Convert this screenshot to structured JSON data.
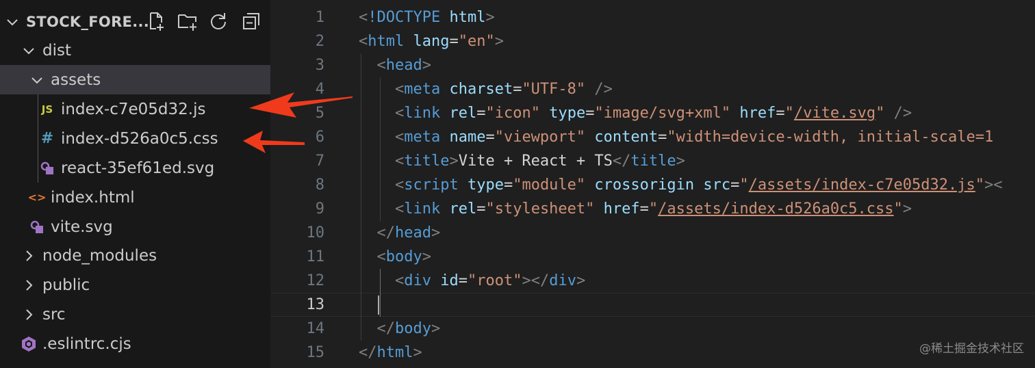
{
  "explorer": {
    "root_label": "STOCK_FORE...",
    "toolbar": [
      {
        "name": "new-file-icon",
        "label": "New File"
      },
      {
        "name": "new-folder-icon",
        "label": "New Folder"
      },
      {
        "name": "refresh-icon",
        "label": "Refresh"
      },
      {
        "name": "collapse-all-icon",
        "label": "Collapse All"
      }
    ],
    "items": [
      {
        "label": "dist",
        "kind": "folder",
        "expanded": true,
        "depth": 1
      },
      {
        "label": "assets",
        "kind": "folder",
        "expanded": true,
        "depth": 2,
        "selected": true
      },
      {
        "label": "index-c7e05d32.js",
        "kind": "js",
        "icon_text": "JS",
        "depth": 3
      },
      {
        "label": "index-d526a0c5.css",
        "kind": "css",
        "icon_text": "#",
        "depth": 3
      },
      {
        "label": "react-35ef61ed.svg",
        "kind": "svg",
        "depth": 3
      },
      {
        "label": "index.html",
        "kind": "html",
        "icon_text": "<>",
        "depth": 2
      },
      {
        "label": "vite.svg",
        "kind": "svg",
        "depth": 2
      },
      {
        "label": "node_modules",
        "kind": "folder",
        "expanded": false,
        "depth": 1
      },
      {
        "label": "public",
        "kind": "folder",
        "expanded": false,
        "depth": 1
      },
      {
        "label": "src",
        "kind": "folder",
        "expanded": false,
        "depth": 1
      },
      {
        "label": ".eslintrc.cjs",
        "kind": "eslint",
        "depth": 1
      }
    ],
    "colors": {
      "js": "#cbcb41",
      "css": "#519aba",
      "html": "#e37933",
      "svg": "#a074c4",
      "eslint": "#a074c4"
    }
  },
  "editor": {
    "current_line": 13,
    "lines": [
      {
        "n": "1",
        "tokens": [
          [
            "t-punc",
            "<"
          ],
          [
            "t-tag",
            "!DOCTYPE"
          ],
          [
            "t-text",
            " "
          ],
          [
            "t-attr",
            "html"
          ],
          [
            "t-punc",
            ">"
          ]
        ]
      },
      {
        "n": "2",
        "tokens": [
          [
            "t-punc",
            "<"
          ],
          [
            "t-tag",
            "html"
          ],
          [
            "t-text",
            " "
          ],
          [
            "t-attr",
            "lang"
          ],
          [
            "t-text",
            "="
          ],
          [
            "t-str",
            "\"en\""
          ],
          [
            "t-punc",
            ">"
          ]
        ]
      },
      {
        "n": "3",
        "tokens": [
          [
            "t-text",
            "  "
          ],
          [
            "t-punc",
            "<"
          ],
          [
            "t-tag",
            "head"
          ],
          [
            "t-punc",
            ">"
          ]
        ]
      },
      {
        "n": "4",
        "tokens": [
          [
            "t-text",
            "    "
          ],
          [
            "t-punc",
            "<"
          ],
          [
            "t-tag",
            "meta"
          ],
          [
            "t-text",
            " "
          ],
          [
            "t-attr",
            "charset"
          ],
          [
            "t-text",
            "="
          ],
          [
            "t-str",
            "\"UTF-8\""
          ],
          [
            "t-text",
            " "
          ],
          [
            "t-punc",
            "/>"
          ]
        ]
      },
      {
        "n": "5",
        "tokens": [
          [
            "t-text",
            "    "
          ],
          [
            "t-punc",
            "<"
          ],
          [
            "t-tag",
            "link"
          ],
          [
            "t-text",
            " "
          ],
          [
            "t-attr",
            "rel"
          ],
          [
            "t-text",
            "="
          ],
          [
            "t-str",
            "\"icon\""
          ],
          [
            "t-text",
            " "
          ],
          [
            "t-attr",
            "type"
          ],
          [
            "t-text",
            "="
          ],
          [
            "t-str",
            "\"image/svg+xml\""
          ],
          [
            "t-text",
            " "
          ],
          [
            "t-attr",
            "href"
          ],
          [
            "t-text",
            "="
          ],
          [
            "t-str",
            "\""
          ],
          [
            "t-str t-link",
            "/vite.svg"
          ],
          [
            "t-str",
            "\""
          ],
          [
            "t-text",
            " "
          ],
          [
            "t-punc",
            "/>"
          ]
        ]
      },
      {
        "n": "6",
        "tokens": [
          [
            "t-text",
            "    "
          ],
          [
            "t-punc",
            "<"
          ],
          [
            "t-tag",
            "meta"
          ],
          [
            "t-text",
            " "
          ],
          [
            "t-attr",
            "name"
          ],
          [
            "t-text",
            "="
          ],
          [
            "t-str",
            "\"viewport\""
          ],
          [
            "t-text",
            " "
          ],
          [
            "t-attr",
            "content"
          ],
          [
            "t-text",
            "="
          ],
          [
            "t-str",
            "\"width=device-width, initial-scale=1"
          ]
        ]
      },
      {
        "n": "7",
        "tokens": [
          [
            "t-text",
            "    "
          ],
          [
            "t-punc",
            "<"
          ],
          [
            "t-tag",
            "title"
          ],
          [
            "t-punc",
            ">"
          ],
          [
            "t-text",
            "Vite + React + TS"
          ],
          [
            "t-punc",
            "</"
          ],
          [
            "t-tag",
            "title"
          ],
          [
            "t-punc",
            ">"
          ]
        ]
      },
      {
        "n": "8",
        "tokens": [
          [
            "t-text",
            "    "
          ],
          [
            "t-punc",
            "<"
          ],
          [
            "t-tag",
            "script"
          ],
          [
            "t-text",
            " "
          ],
          [
            "t-attr",
            "type"
          ],
          [
            "t-text",
            "="
          ],
          [
            "t-str",
            "\"module\""
          ],
          [
            "t-text",
            " "
          ],
          [
            "t-attr",
            "crossorigin"
          ],
          [
            "t-text",
            " "
          ],
          [
            "t-attr",
            "src"
          ],
          [
            "t-text",
            "="
          ],
          [
            "t-str",
            "\""
          ],
          [
            "t-str t-link",
            "/assets/index-c7e05d32.js"
          ],
          [
            "t-str",
            "\""
          ],
          [
            "t-punc",
            "><"
          ]
        ]
      },
      {
        "n": "9",
        "tokens": [
          [
            "t-text",
            "    "
          ],
          [
            "t-punc",
            "<"
          ],
          [
            "t-tag",
            "link"
          ],
          [
            "t-text",
            " "
          ],
          [
            "t-attr",
            "rel"
          ],
          [
            "t-text",
            "="
          ],
          [
            "t-str",
            "\"stylesheet\""
          ],
          [
            "t-text",
            " "
          ],
          [
            "t-attr",
            "href"
          ],
          [
            "t-text",
            "="
          ],
          [
            "t-str",
            "\""
          ],
          [
            "t-str t-link",
            "/assets/index-d526a0c5.css"
          ],
          [
            "t-str",
            "\""
          ],
          [
            "t-punc",
            ">"
          ]
        ]
      },
      {
        "n": "10",
        "tokens": [
          [
            "t-text",
            "  "
          ],
          [
            "t-punc",
            "</"
          ],
          [
            "t-tag",
            "head"
          ],
          [
            "t-punc",
            ">"
          ]
        ]
      },
      {
        "n": "11",
        "tokens": [
          [
            "t-text",
            "  "
          ],
          [
            "t-punc",
            "<"
          ],
          [
            "t-tag",
            "body"
          ],
          [
            "t-punc",
            ">"
          ]
        ]
      },
      {
        "n": "12",
        "tokens": [
          [
            "t-text",
            "    "
          ],
          [
            "t-punc",
            "<"
          ],
          [
            "t-tag",
            "div"
          ],
          [
            "t-text",
            " "
          ],
          [
            "t-attr",
            "id"
          ],
          [
            "t-text",
            "="
          ],
          [
            "t-str",
            "\"root\""
          ],
          [
            "t-punc",
            "></"
          ],
          [
            "t-tag",
            "div"
          ],
          [
            "t-punc",
            ">"
          ]
        ]
      },
      {
        "n": "13",
        "tokens": []
      },
      {
        "n": "14",
        "tokens": [
          [
            "t-text",
            "  "
          ],
          [
            "t-punc",
            "</"
          ],
          [
            "t-tag",
            "body"
          ],
          [
            "t-punc",
            ">"
          ]
        ]
      },
      {
        "n": "15",
        "tokens": [
          [
            "t-punc",
            "</"
          ],
          [
            "t-tag",
            "html"
          ],
          [
            "t-punc",
            ">"
          ]
        ]
      }
    ]
  },
  "watermark": "@稀土掘金技术社区"
}
